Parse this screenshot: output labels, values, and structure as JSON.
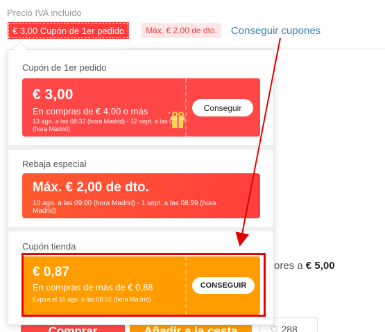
{
  "header": {
    "price_label": "Precio IVA incluido",
    "coupon_tag": "€ 3,00 Cupón de 1er pedido",
    "discount_tag": "Máx. € 2,00 de dto.",
    "get_coupons": "Conseguir cupones"
  },
  "popup": {
    "first_order": {
      "title": "Cupón de 1er pedido",
      "amount": "€ 3,00",
      "condition": "En compras de € 4,00 o más",
      "dates": "13 ago. a las 08:32 (hora Madrid) - 12 sept. a las 08:32 (hora Madrid)",
      "button": "Conseguir"
    },
    "special": {
      "title": "Rebaja especial",
      "amount": "Máx. € 2,00 de dto.",
      "dates": "10 ago. a las 09:00 (hora Madrid) - 1 sept. a las 08:59 (hora Madrid)"
    },
    "store": {
      "title": "Cupón tienda",
      "amount": "€ 0,87",
      "condition": "En compras de más de € 0,88",
      "dates": "Expira el 16 ago. a las 08:32 (hora Madrid)",
      "button": "CONSEGUIR"
    }
  },
  "background": {
    "price_text": "ores a",
    "price_value": "€ 5,00",
    "buy_button": "Comprar",
    "cart_button": "Añadir a la cesta",
    "wishlist_count": "288"
  },
  "colors": {
    "red": "#ff4747",
    "orange": "#ff9c00",
    "link_blue": "#3a7fbf",
    "annotation_red": "#e00000"
  }
}
